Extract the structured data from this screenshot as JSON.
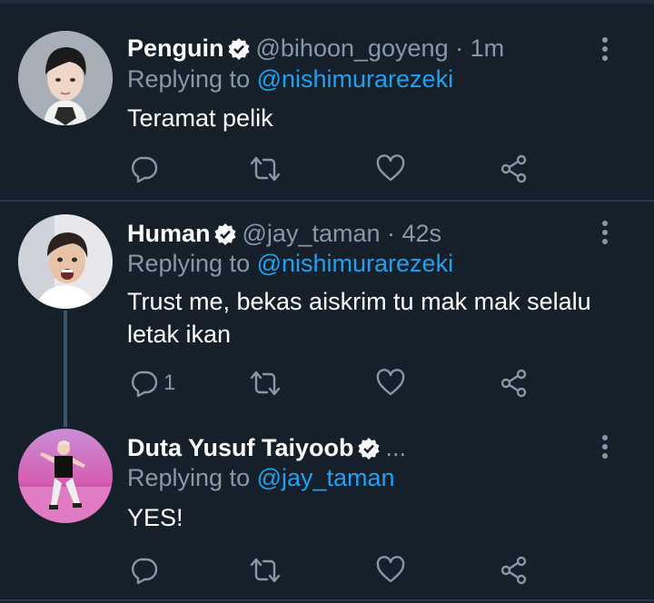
{
  "colors": {
    "background": "#15202b",
    "muted": "#8899a6",
    "link": "#1da1f2",
    "divider": "#2b3a4a"
  },
  "tweets": [
    {
      "name": "Penguin",
      "verified": true,
      "handle": "@bihoon_goyeng",
      "time_sep": " · ",
      "time": "1m",
      "replying_prefix": "Replying to ",
      "replying_to": "@nishimurarezeki",
      "text": "Teramat pelik",
      "reply_count": ""
    },
    {
      "name": "Human",
      "verified": true,
      "handle": "@jay_taman",
      "time_sep": " · ",
      "time": "42s",
      "replying_prefix": "Replying to ",
      "replying_to": "@nishimurarezeki",
      "text": "Trust me, bekas aiskrim tu mak mak selalu letak ikan",
      "reply_count": "1"
    },
    {
      "name": "Duta Yusuf Taiyoob",
      "verified": true,
      "handle": "...",
      "time_sep": "",
      "time": "",
      "replying_prefix": "Replying to ",
      "replying_to": "@jay_taman",
      "text": "YES!",
      "reply_count": ""
    }
  ],
  "icons": {
    "reply": "reply-icon",
    "retweet": "retweet-icon",
    "like": "like-icon",
    "share": "share-icon",
    "more": "more-vertical-icon",
    "verified": "verified-badge-icon"
  }
}
